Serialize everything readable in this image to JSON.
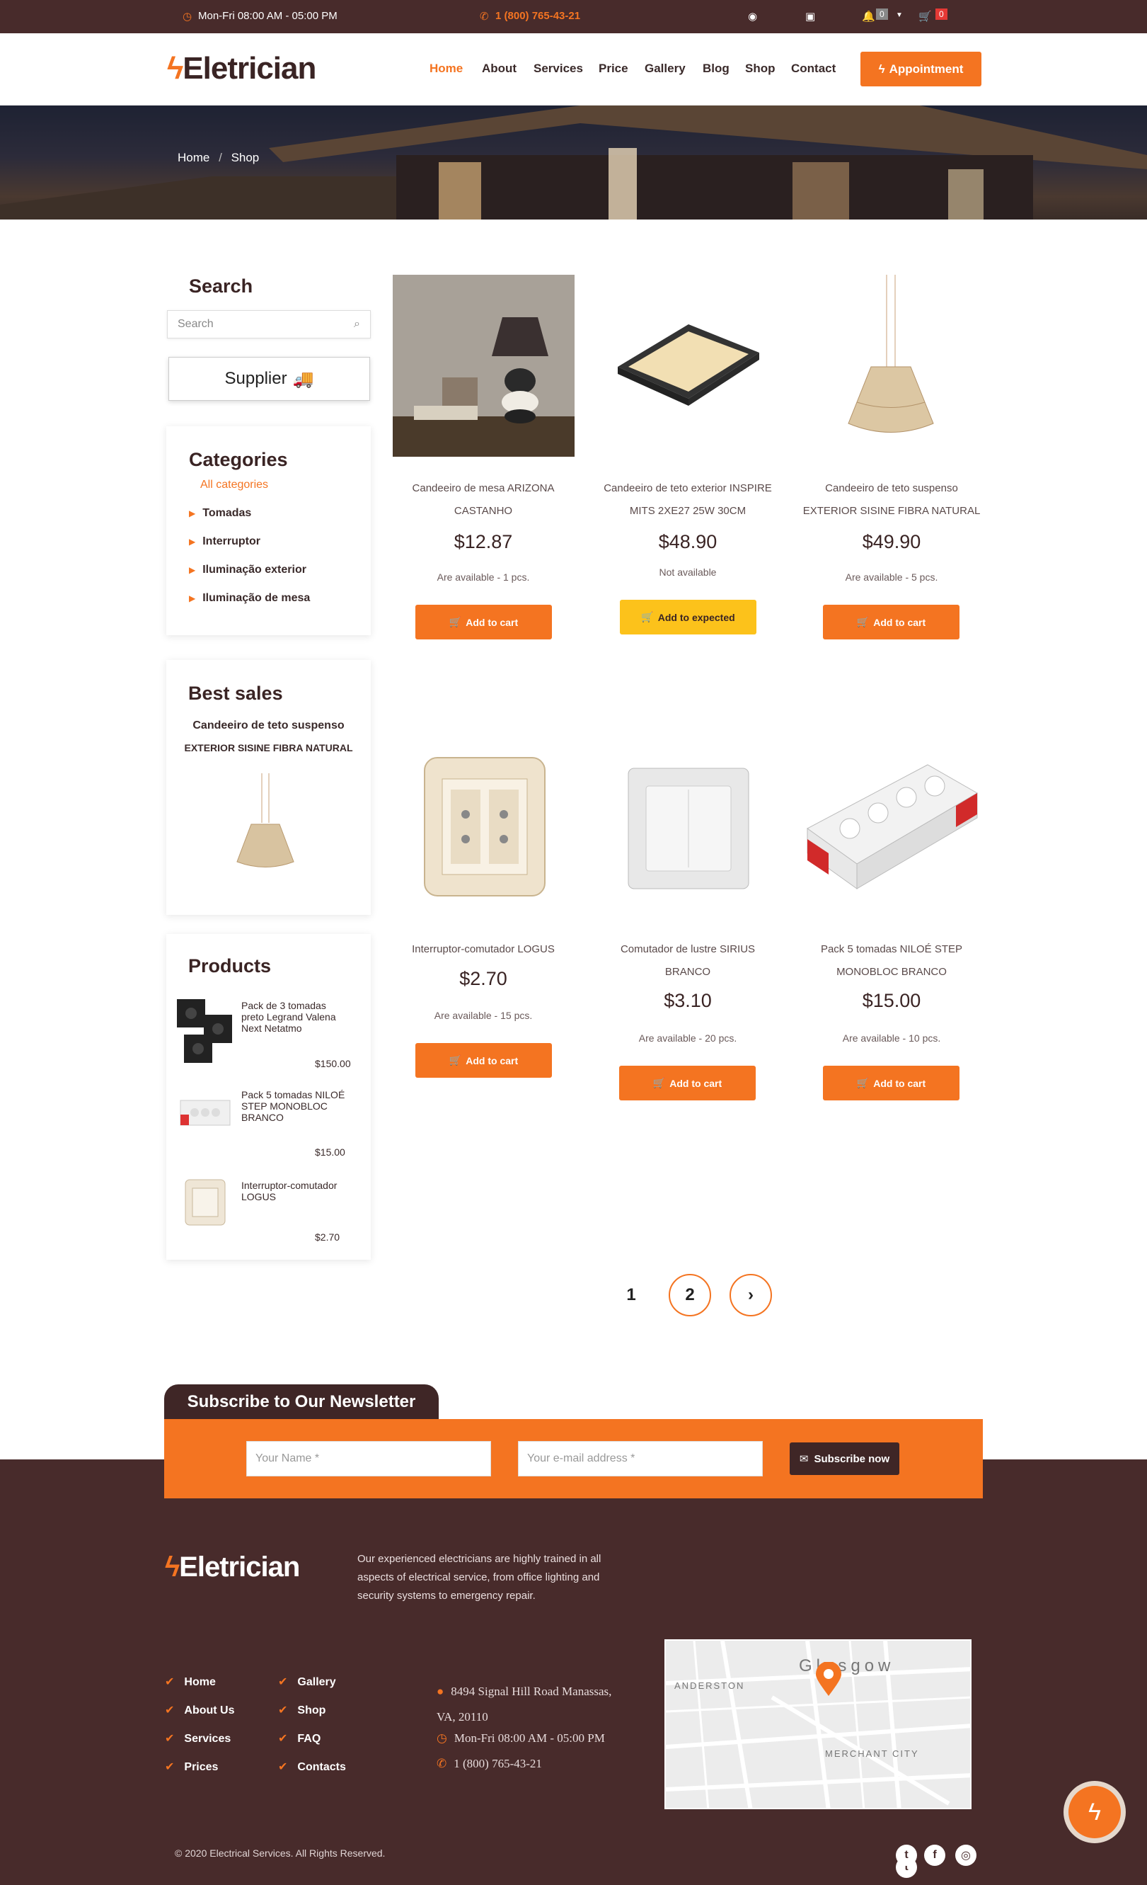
{
  "topbar": {
    "hours": "Mon-Fri 08:00 AM - 05:00 PM",
    "phone": "1 (800) 765-43-21",
    "notif_count": "0",
    "cart_count": "0"
  },
  "brand": {
    "name": "Eletrician",
    "accent": "#f47421",
    "dark": "#482b2b"
  },
  "nav": {
    "items": [
      "Home",
      "About",
      "Services",
      "Price",
      "Gallery",
      "Blog",
      "Shop",
      "Contact"
    ],
    "appointment": "Appointment"
  },
  "breadcrumb": {
    "home": "Home",
    "sep": "/",
    "current": "Shop"
  },
  "sidebar": {
    "search_title": "Search",
    "search_placeholder": "Search",
    "supplier": "Supplier",
    "categories_title": "Categories",
    "all_categories": "All categories",
    "categories": [
      "Tomadas",
      "Interruptor",
      "Iluminação exterior",
      "Iluminação de mesa"
    ],
    "best_sales_title": "Best sales",
    "best_sales_line1": "Candeeiro de teto suspenso",
    "best_sales_line2": "EXTERIOR SISINE FIBRA NATURAL",
    "products_title": "Products",
    "products": [
      {
        "name": "Pack de 3 tomadas preto Legrand Valena Next Netatmo",
        "price": "$150.00"
      },
      {
        "name": "Pack 5 tomadas NILOÉ STEP MONOBLOC BRANCO",
        "price": "$15.00"
      },
      {
        "name": "Interruptor-comutador LOGUS",
        "price": "$2.70"
      }
    ]
  },
  "products": [
    {
      "l1": "Candeeiro de mesa ARIZONA",
      "l2": "CASTANHO",
      "price": "$12.87",
      "avail": "Are available - 1 pcs.",
      "btn": "Add to cart"
    },
    {
      "l1": "Candeeiro de teto exterior INSPIRE",
      "l2": "MITS 2XE27 25W 30CM",
      "price": "$48.90",
      "avail": "Not available",
      "btn": "Add to expected"
    },
    {
      "l1": "Candeeiro de teto suspenso",
      "l2": "EXTERIOR SISINE FIBRA NATURAL",
      "price": "$49.90",
      "avail": "Are available - 5 pcs.",
      "btn": "Add to cart"
    },
    {
      "l1": "Interruptor-comutador LOGUS",
      "l2": "",
      "price": "$2.70",
      "avail": "Are available - 15 pcs.",
      "btn": "Add to cart"
    },
    {
      "l1": "Comutador de lustre SIRIUS",
      "l2": "BRANCO",
      "price": "$3.10",
      "avail": "Are available - 20 pcs.",
      "btn": "Add to cart"
    },
    {
      "l1": "Pack 5 tomadas NILOÉ STEP",
      "l2": "MONOBLOC BRANCO",
      "price": "$15.00",
      "avail": "Are available - 10 pcs.",
      "btn": "Add to cart"
    }
  ],
  "pagination": {
    "p1": "1",
    "p2": "2",
    "next": "›"
  },
  "newsletter": {
    "title": "Subscribe to Our Newsletter",
    "name_placeholder": "Your Name *",
    "email_placeholder": "Your e-mail address *",
    "button": "Subscribe now"
  },
  "footer": {
    "about_l1": "Our experienced electricians are highly trained in all",
    "about_l2": "aspects of electrical service, from office lighting and",
    "about_l3": "security systems to emergency repair.",
    "links_col1": [
      "Home",
      "About Us",
      "Services",
      "Prices"
    ],
    "links_col2": [
      "Gallery",
      "Shop",
      "FAQ",
      "Contacts"
    ],
    "address_l1": "8494 Signal Hill Road Manassas,",
    "address_l2": "VA, 20110",
    "hours": "Mon-Fri 08:00 AM - 05:00 PM",
    "phone": "1 (800) 765-43-21",
    "map_city": "Glasgow",
    "map_anderston": "ANDERSTON",
    "map_merchant": "MERCHANT CITY",
    "copyright": "© 2020 Electrical Services. All Rights Reserved."
  }
}
